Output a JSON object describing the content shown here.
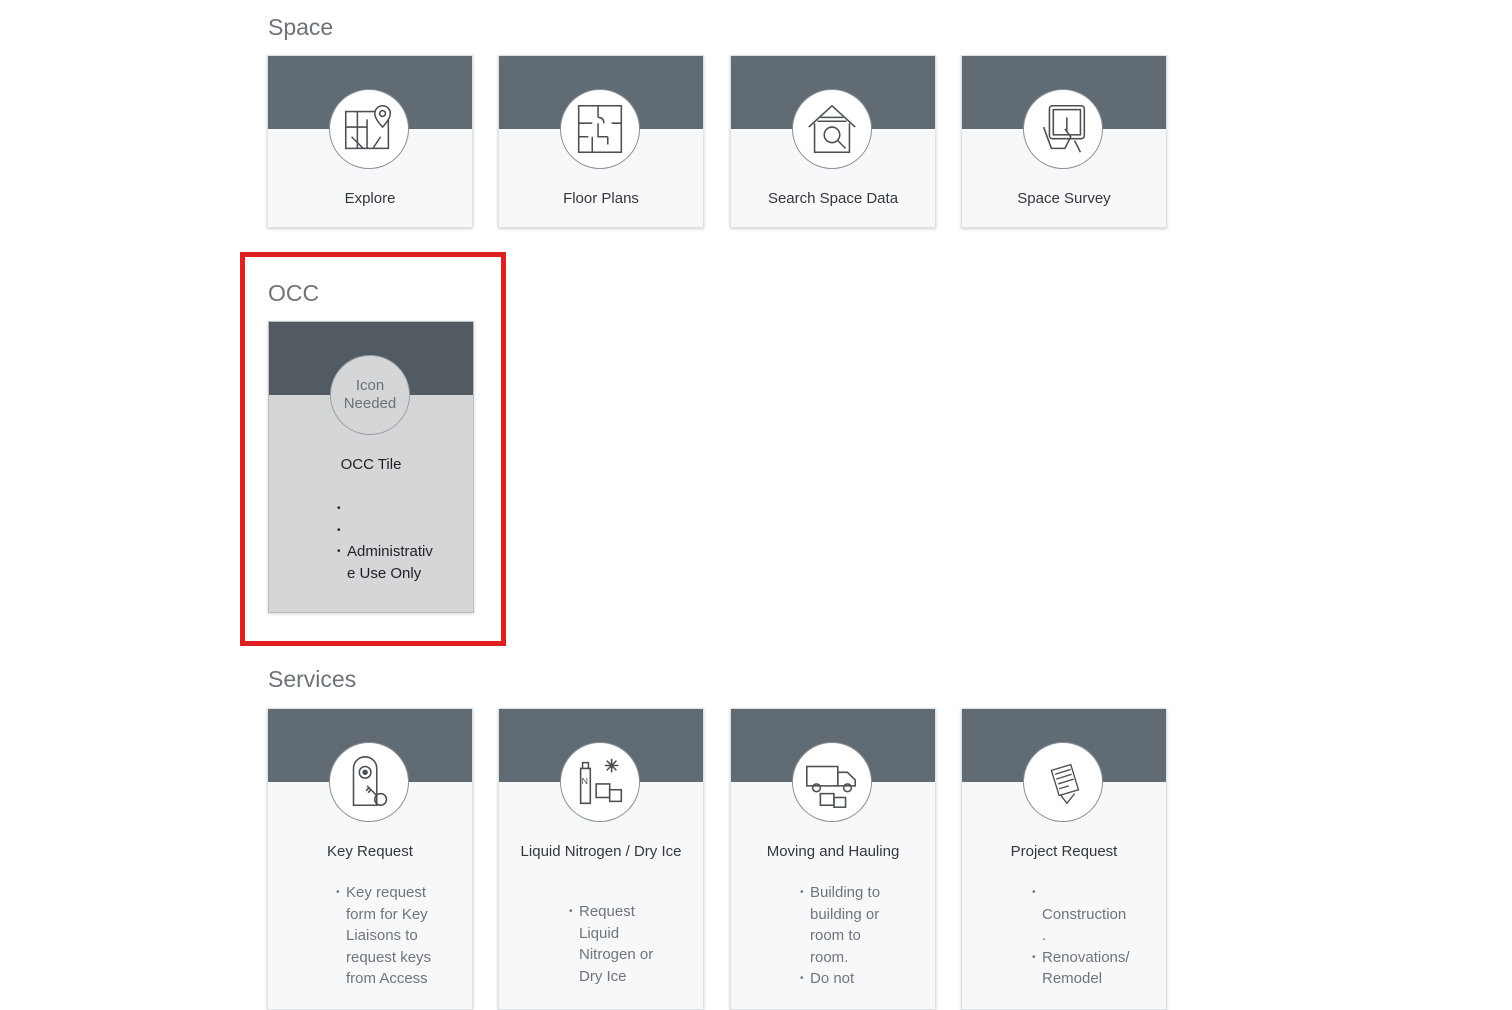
{
  "sections": {
    "space": {
      "title": "Space",
      "tiles": [
        {
          "label": "Explore",
          "icon": "map-pin-icon"
        },
        {
          "label": "Floor Plans",
          "icon": "floor-plan-icon"
        },
        {
          "label": "Search Space Data",
          "icon": "house-search-icon"
        },
        {
          "label": "Space Survey",
          "icon": "tablet-touch-icon"
        }
      ]
    },
    "occ": {
      "title": "OCC",
      "tile": {
        "icon_placeholder": [
          "Icon",
          "Needed"
        ],
        "label": "OCC Tile",
        "bullet_blank": "",
        "bullet_text": [
          "Administrativ",
          "e Use Only"
        ]
      }
    },
    "services": {
      "title": "Services",
      "tiles": [
        {
          "label": "Key Request",
          "icon": "key-lock-icon",
          "bullets": [
            [
              "Key request",
              "form for Key",
              "Liaisons to",
              "request keys",
              "from Access"
            ]
          ]
        },
        {
          "label": "Liquid Nitrogen / Dry Ice",
          "icon": "nitrogen-ice-icon",
          "bullets": [
            [
              "Request",
              "Liquid",
              "Nitrogen or",
              "Dry Ice"
            ]
          ]
        },
        {
          "label": "Moving and Hauling",
          "icon": "moving-truck-icon",
          "bullets": [
            [
              "Building to",
              "building or",
              "room to",
              "room."
            ],
            [
              "Do not"
            ]
          ]
        },
        {
          "label": "Project Request",
          "icon": "clipboard-icon",
          "bullets": [
            [
              "",
              "Construction",
              "."
            ],
            [
              "Renovations/",
              "Remodel"
            ]
          ]
        }
      ]
    }
  },
  "colors": {
    "tile_band": "#616b74",
    "occ_band": "#525a62",
    "highlight_border": "#e02020"
  }
}
